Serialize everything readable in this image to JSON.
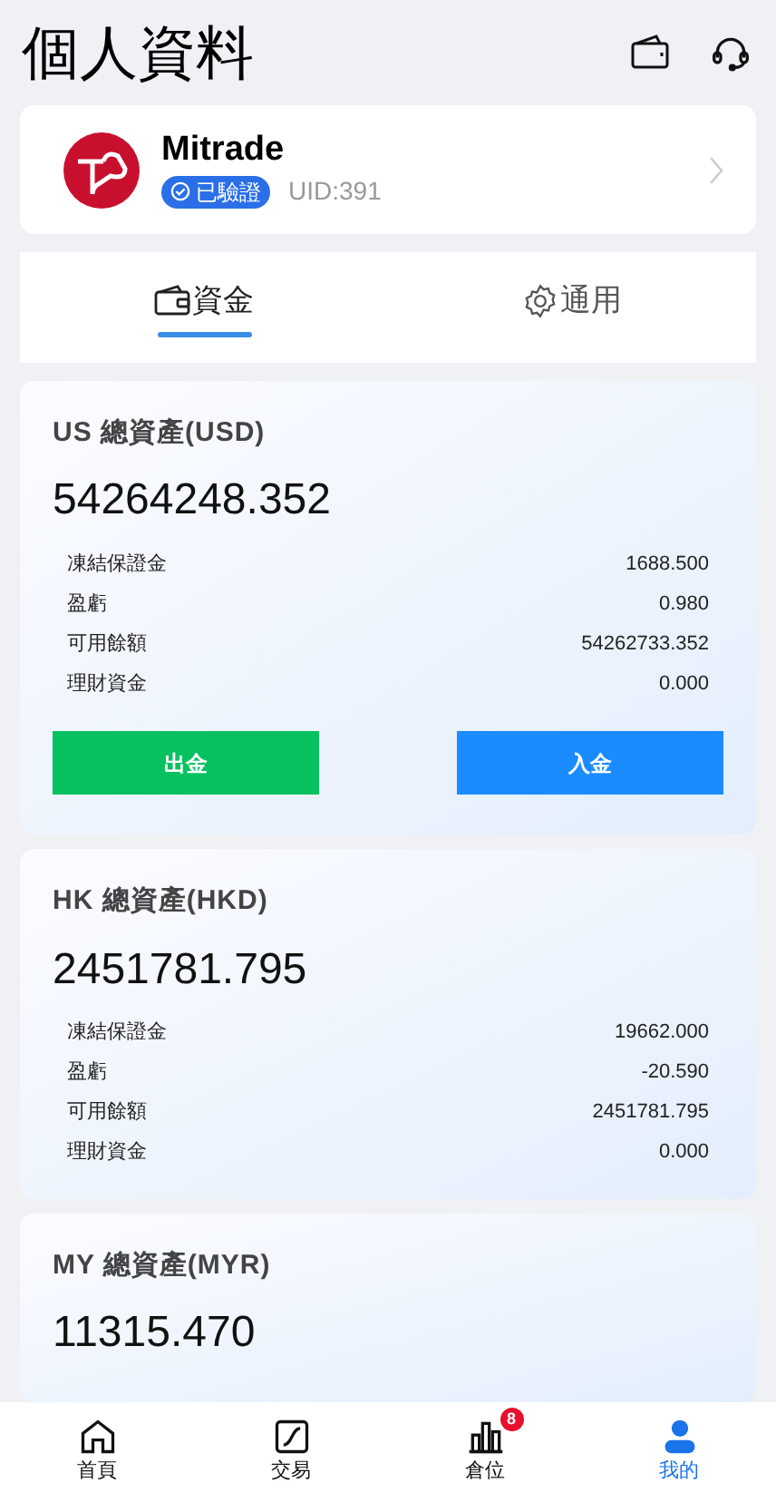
{
  "header": {
    "title": "個人資料"
  },
  "profile": {
    "name": "Mitrade",
    "badge": "已驗證",
    "uid": "UID:391"
  },
  "tabs": [
    {
      "label": "資金",
      "selected": true
    },
    {
      "label": "通用",
      "selected": false
    }
  ],
  "accounts": [
    {
      "title": "US 總資產(USD)",
      "total": "54264248.352",
      "rows": [
        {
          "label": "凍結保證金",
          "value": "1688.500"
        },
        {
          "label": "盈虧",
          "value": "0.980"
        },
        {
          "label": "可用餘額",
          "value": "54262733.352"
        },
        {
          "label": "理財資金",
          "value": "0.000"
        }
      ],
      "buttons": [
        {
          "label": "出金",
          "kind": "withdraw"
        },
        {
          "label": "入金",
          "kind": "deposit"
        }
      ]
    },
    {
      "title": "HK 總資產(HKD)",
      "total": "2451781.795",
      "rows": [
        {
          "label": "凍結保證金",
          "value": "19662.000"
        },
        {
          "label": "盈虧",
          "value": "-20.590"
        },
        {
          "label": "可用餘額",
          "value": "2451781.795"
        },
        {
          "label": "理財資金",
          "value": "0.000"
        }
      ]
    },
    {
      "title": "MY 總資產(MYR)",
      "total": "11315.470"
    }
  ],
  "nav": [
    {
      "label": "首頁",
      "selected": false
    },
    {
      "label": "交易",
      "selected": false
    },
    {
      "label": "倉位",
      "selected": false,
      "badge": "8"
    },
    {
      "label": "我的",
      "selected": true
    }
  ]
}
